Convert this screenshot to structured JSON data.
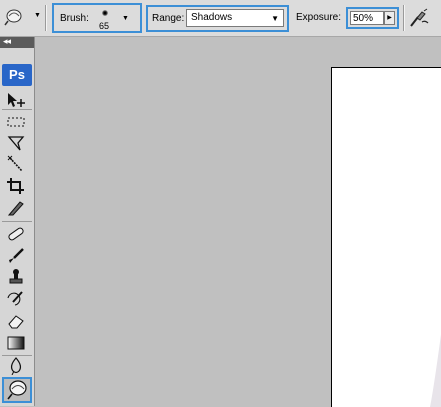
{
  "options_bar": {
    "tool_icon": "dodge-tool-icon",
    "brush": {
      "label": "Brush:",
      "size": "65"
    },
    "range": {
      "label": "Range:",
      "value": "Shadows"
    },
    "exposure": {
      "label": "Exposure:",
      "value": "50%"
    },
    "airbrush_icon": "airbrush-icon"
  },
  "toolbox": {
    "logo": "Ps",
    "tools": [
      "move-tool-icon",
      "marquee-tool-icon",
      "lasso-tool-icon",
      "magic-wand-tool-icon",
      "crop-tool-icon",
      "slice-tool-icon",
      "healing-brush-tool-icon",
      "brush-tool-icon",
      "clone-stamp-tool-icon",
      "history-brush-tool-icon",
      "eraser-tool-icon",
      "gradient-tool-icon",
      "blur-tool-icon",
      "dodge-tool-icon"
    ],
    "selected_tool": "dodge-tool-icon"
  },
  "colors": {
    "highlight": "#3c8fd6",
    "ps_logo": "#2966c8",
    "workspace": "#c0c0c0"
  }
}
